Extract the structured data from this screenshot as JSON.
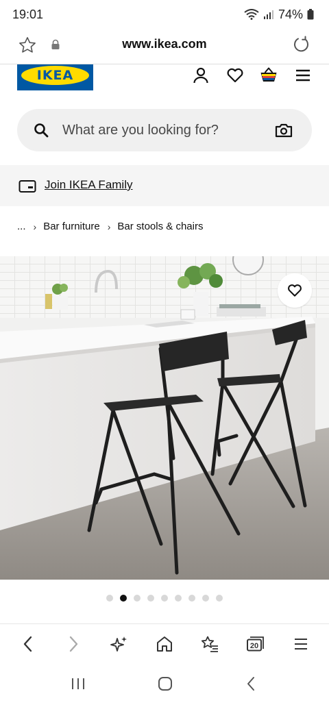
{
  "status": {
    "time": "19:01",
    "battery": "74%"
  },
  "browser": {
    "url": "www.ikea.com",
    "tab_count": "20"
  },
  "brand": {
    "logo_text": "IKEA",
    "yellow": "#ffdb00",
    "blue": "#0058a3"
  },
  "search": {
    "placeholder": "What are you looking for?"
  },
  "family": {
    "link_label": "Join IKEA Family"
  },
  "breadcrumb": {
    "ellipsis": "...",
    "items": [
      "Bar furniture",
      "Bar stools & chairs"
    ]
  },
  "carousel": {
    "total": 9,
    "active_index": 1
  }
}
